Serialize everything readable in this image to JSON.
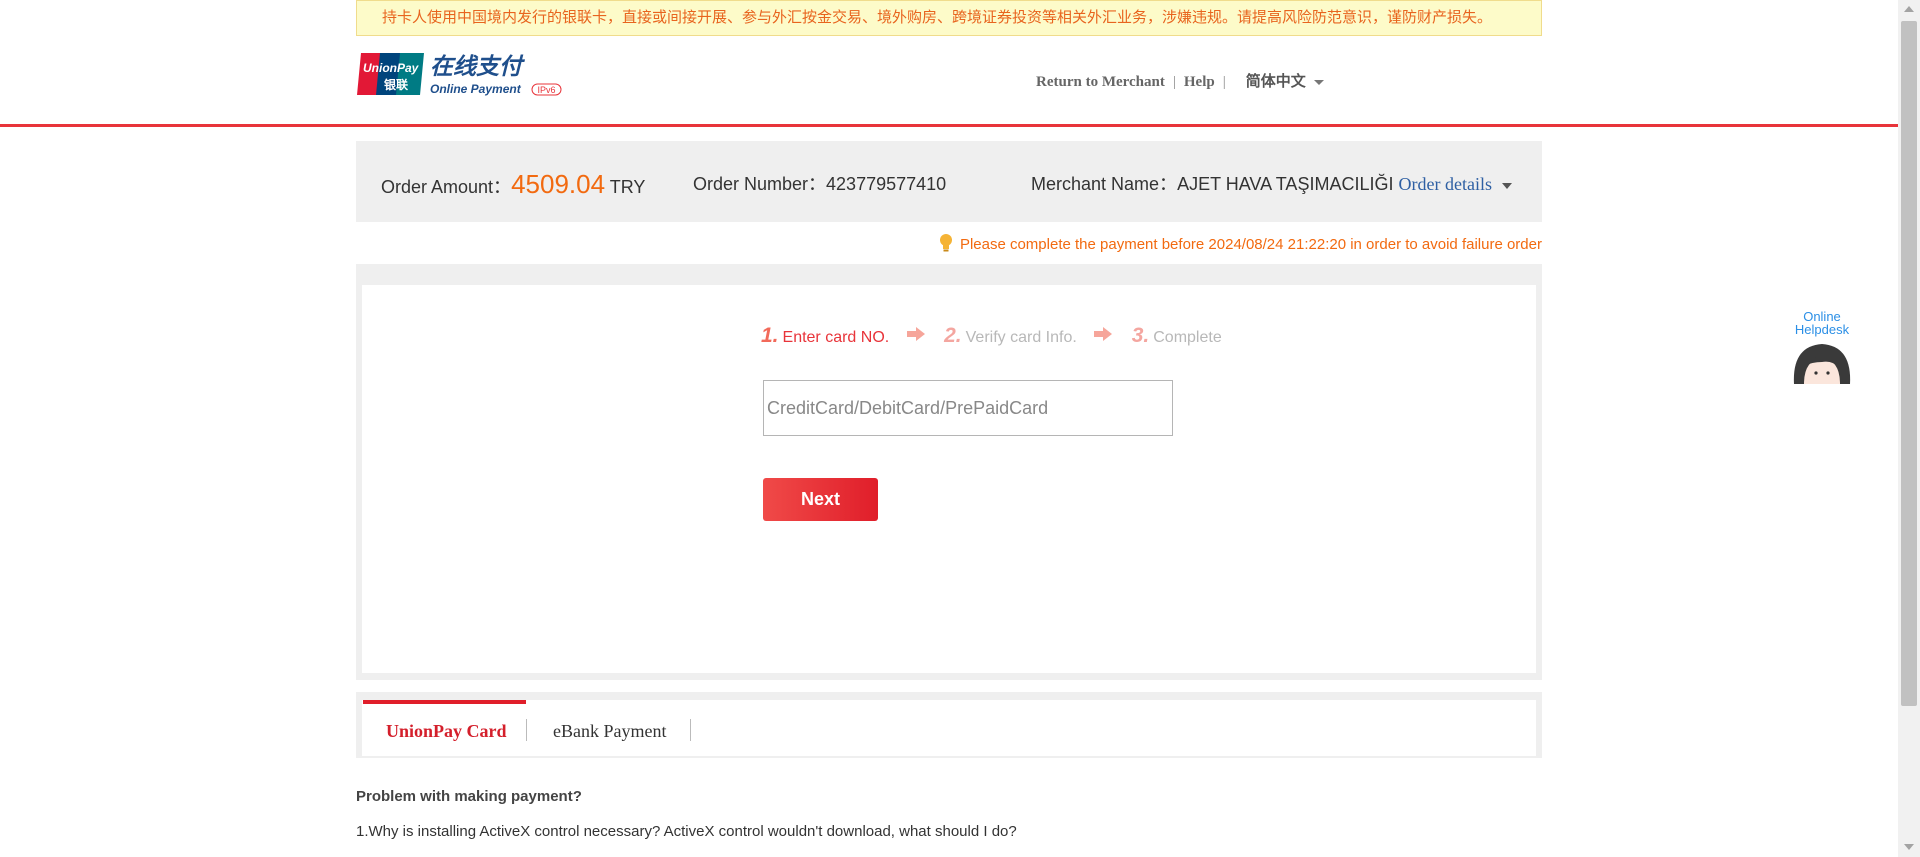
{
  "notice": {
    "text": "持卡人使用中国境内发行的银联卡，直接或间接开展、参与外汇按金交易、境外购房、跨境证券投资等相关外汇业务，涉嫌违规。请提高风险防范意识，谨防财产损失。"
  },
  "logo": {
    "brand_line1": "UnionPay",
    "brand_line2": "银联",
    "title_cn": "在线支付",
    "subtitle": "Online Payment",
    "badge": "IPv6"
  },
  "nav": {
    "return_label": "Return to Merchant",
    "separator": "|",
    "help_label": "Help",
    "language_label": "简体中文"
  },
  "order": {
    "amount_label": "Order Amount：",
    "amount_value": "4509.04",
    "currency": "TRY",
    "number_label": "Order Number：",
    "number_value": "423779577410",
    "merchant_label": "Merchant Name：",
    "merchant_value": "AJET HAVA TAŞIMACILIĞI",
    "details_link": "Order details"
  },
  "deadline": {
    "text": "Please complete the payment before 2024/08/24 21:22:20 in order to avoid failure order"
  },
  "steps": [
    {
      "num": "1.",
      "label": "Enter card NO."
    },
    {
      "num": "2.",
      "label": "Verify card Info."
    },
    {
      "num": "3.",
      "label": "Complete"
    }
  ],
  "card_input": {
    "value": "",
    "placeholder": "CreditCard/DebitCard/PrePaidCard"
  },
  "next_button": {
    "label": "Next"
  },
  "tabs": [
    {
      "label": "UnionPay Card"
    },
    {
      "label": "eBank Payment"
    }
  ],
  "faq": {
    "title": "Problem with making payment?",
    "items": [
      "1.Why is installing ActiveX control necessary? ActiveX control wouldn't download, what should I do?"
    ]
  },
  "helpdesk": {
    "line1": "Online",
    "line2": "Helpdesk"
  },
  "colors": {
    "accent_red": "#e01e2a",
    "amount_orange": "#f26a10",
    "link_blue": "#2e5fa3"
  }
}
